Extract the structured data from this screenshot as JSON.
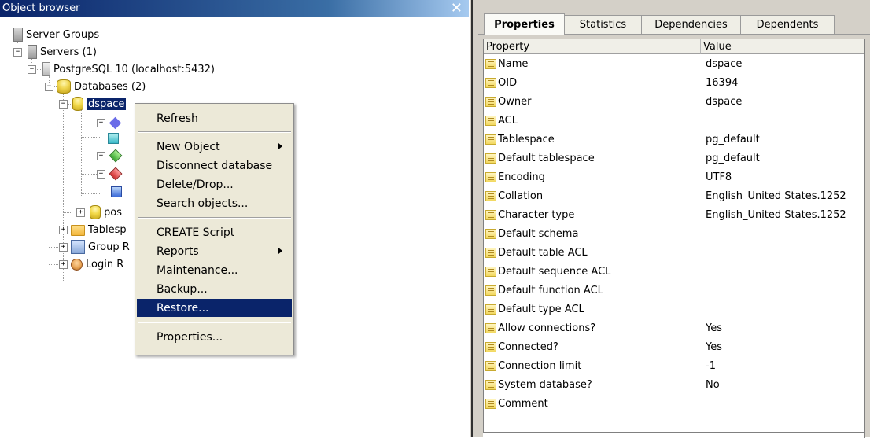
{
  "object_browser": {
    "title": "Object browser",
    "close_glyph": "✕",
    "tree": {
      "server_groups": "Server Groups",
      "servers": "Servers (1)",
      "postgres": "PostgreSQL 10 (localhost:5432)",
      "databases": "Databases (2)",
      "dspace": "dspace",
      "postgres_db": "pos",
      "tablespaces": "Tablesp",
      "group_roles": "Group R",
      "login_roles": "Login R"
    },
    "expander_minus": "−",
    "expander_plus": "+"
  },
  "context_menu": {
    "refresh": "Refresh",
    "new_object": "New Object",
    "disconnect": "Disconnect database",
    "delete_drop": "Delete/Drop...",
    "search_objects": "Search objects...",
    "create_script": "CREATE Script",
    "reports": "Reports",
    "maintenance": "Maintenance...",
    "backup": "Backup...",
    "restore": "Restore...",
    "properties": "Properties..."
  },
  "tabs": [
    "Properties",
    "Statistics",
    "Dependencies",
    "Dependents"
  ],
  "grid": {
    "col_property": "Property",
    "col_value": "Value",
    "rows": [
      {
        "name": "Name",
        "value": "dspace"
      },
      {
        "name": "OID",
        "value": "16394"
      },
      {
        "name": "Owner",
        "value": "dspace"
      },
      {
        "name": "ACL",
        "value": ""
      },
      {
        "name": "Tablespace",
        "value": "pg_default"
      },
      {
        "name": "Default tablespace",
        "value": "pg_default"
      },
      {
        "name": "Encoding",
        "value": "UTF8"
      },
      {
        "name": "Collation",
        "value": "English_United States.1252"
      },
      {
        "name": "Character type",
        "value": "English_United States.1252"
      },
      {
        "name": "Default schema",
        "value": ""
      },
      {
        "name": "Default table ACL",
        "value": ""
      },
      {
        "name": "Default sequence ACL",
        "value": ""
      },
      {
        "name": "Default function ACL",
        "value": ""
      },
      {
        "name": "Default type ACL",
        "value": ""
      },
      {
        "name": "Allow connections?",
        "value": "Yes"
      },
      {
        "name": "Connected?",
        "value": "Yes"
      },
      {
        "name": "Connection limit",
        "value": "-1"
      },
      {
        "name": "System database?",
        "value": "No"
      },
      {
        "name": "Comment",
        "value": ""
      }
    ]
  }
}
